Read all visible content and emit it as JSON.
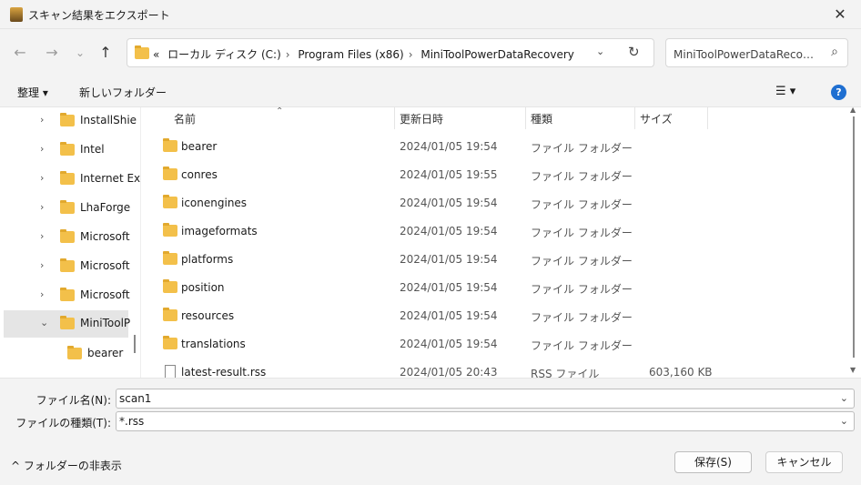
{
  "window": {
    "title": "スキャン結果をエクスポート",
    "close_glyph": "✕"
  },
  "nav": {
    "back": "←",
    "forward": "→",
    "recent": "⌄",
    "up": "↑",
    "breadcrumbs": [
      "ローカル ディスク (C:)",
      "Program Files (x86)",
      "MiniToolPowerDataRecovery"
    ],
    "crumb_prefix": "«",
    "search_placeholder": "MiniToolPowerDataRecoveryの検索"
  },
  "toolbar": {
    "organize": "整理 ▾",
    "new_folder": "新しいフォルダー",
    "view_glyph": "☰ ▾",
    "help": "?"
  },
  "tree": [
    {
      "label": "InstallShie",
      "selected": false,
      "expanded": false
    },
    {
      "label": "Intel",
      "selected": false,
      "expanded": false
    },
    {
      "label": "Internet Ex",
      "selected": false,
      "expanded": false
    },
    {
      "label": "LhaForge",
      "selected": false,
      "expanded": false
    },
    {
      "label": "Microsoft",
      "selected": false,
      "expanded": false
    },
    {
      "label": "Microsoft",
      "selected": false,
      "expanded": false
    },
    {
      "label": "Microsoft",
      "selected": false,
      "expanded": false
    },
    {
      "label": "MiniToolP",
      "selected": true,
      "expanded": true
    },
    {
      "label": "bearer",
      "selected": false,
      "child": true
    }
  ],
  "columns": {
    "name": "名前",
    "date": "更新日時",
    "type": "種類",
    "size": "サイズ"
  },
  "files": [
    {
      "name": "bearer",
      "date": "2024/01/05 19:54",
      "type": "ファイル フォルダー",
      "size": "",
      "kind": "folder"
    },
    {
      "name": "conres",
      "date": "2024/01/05 19:55",
      "type": "ファイル フォルダー",
      "size": "",
      "kind": "folder"
    },
    {
      "name": "iconengines",
      "date": "2024/01/05 19:54",
      "type": "ファイル フォルダー",
      "size": "",
      "kind": "folder"
    },
    {
      "name": "imageformats",
      "date": "2024/01/05 19:54",
      "type": "ファイル フォルダー",
      "size": "",
      "kind": "folder"
    },
    {
      "name": "platforms",
      "date": "2024/01/05 19:54",
      "type": "ファイル フォルダー",
      "size": "",
      "kind": "folder"
    },
    {
      "name": "position",
      "date": "2024/01/05 19:54",
      "type": "ファイル フォルダー",
      "size": "",
      "kind": "folder"
    },
    {
      "name": "resources",
      "date": "2024/01/05 19:54",
      "type": "ファイル フォルダー",
      "size": "",
      "kind": "folder"
    },
    {
      "name": "translations",
      "date": "2024/01/05 19:54",
      "type": "ファイル フォルダー",
      "size": "",
      "kind": "folder"
    },
    {
      "name": "latest-result.rss",
      "date": "2024/01/05 20:43",
      "type": "RSS ファイル",
      "size": "603,160 KB",
      "kind": "file"
    }
  ],
  "form": {
    "filename_label": "ファイル名(N):",
    "filename_value": "scan1",
    "filetype_label": "ファイルの種類(T):",
    "filetype_value": "*.rss",
    "hide_folders": "^  フォルダーの非表示",
    "save": "保存(S)",
    "cancel": "キャンセル"
  }
}
